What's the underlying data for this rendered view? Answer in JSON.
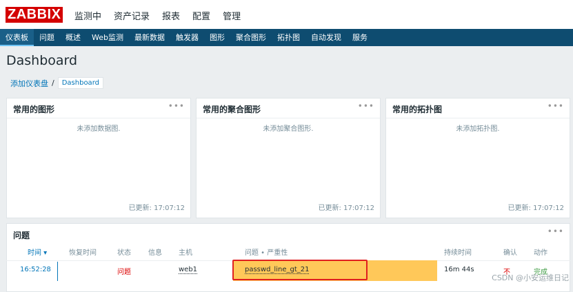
{
  "app": {
    "logo": "ZABBIX"
  },
  "main_menu": [
    "监测中",
    "资产记录",
    "报表",
    "配置",
    "管理"
  ],
  "sub_menu": [
    "仪表板",
    "问题",
    "概述",
    "Web监测",
    "最新数据",
    "触发器",
    "图形",
    "聚合图形",
    "拓扑图",
    "自动发现",
    "服务"
  ],
  "page": {
    "title": "Dashboard"
  },
  "breadcrumb": {
    "parent": "添加仪表盘",
    "separator": "/",
    "current": "Dashboard"
  },
  "widgets": [
    {
      "title": "常用的图形",
      "empty": "未添加数据图.",
      "updated": "已更新: 17:07:12",
      "menu": "•••"
    },
    {
      "title": "常用的聚合图形",
      "empty": "未添加聚合图形.",
      "updated": "已更新: 17:07:12",
      "menu": "•••"
    },
    {
      "title": "常用的拓扑图",
      "empty": "未添加拓扑图.",
      "updated": "已更新: 17:07:12",
      "menu": "•••"
    }
  ],
  "problems": {
    "title": "问题",
    "menu": "•••",
    "columns": {
      "time": "时间 ▾",
      "recovery": "恢复时间",
      "status": "状态",
      "info": "信息",
      "host": "主机",
      "problem": "问题 • 严重性",
      "duration": "持续时间",
      "ack": "确认",
      "actions": "动作"
    },
    "row": {
      "time": "16:52:28",
      "status": "问题",
      "host": "web1",
      "problem": "passwd_line_gt_21",
      "duration": "16m 44s",
      "ack": "不",
      "actions": "完成"
    }
  },
  "watermark": "CSDN @小安运维日记",
  "colors": {
    "brand": "#d40000",
    "nav": "#0e4c70",
    "problem_highlight": "#ffc859",
    "problem_status": "#dc0000",
    "link": "#0275b8"
  }
}
